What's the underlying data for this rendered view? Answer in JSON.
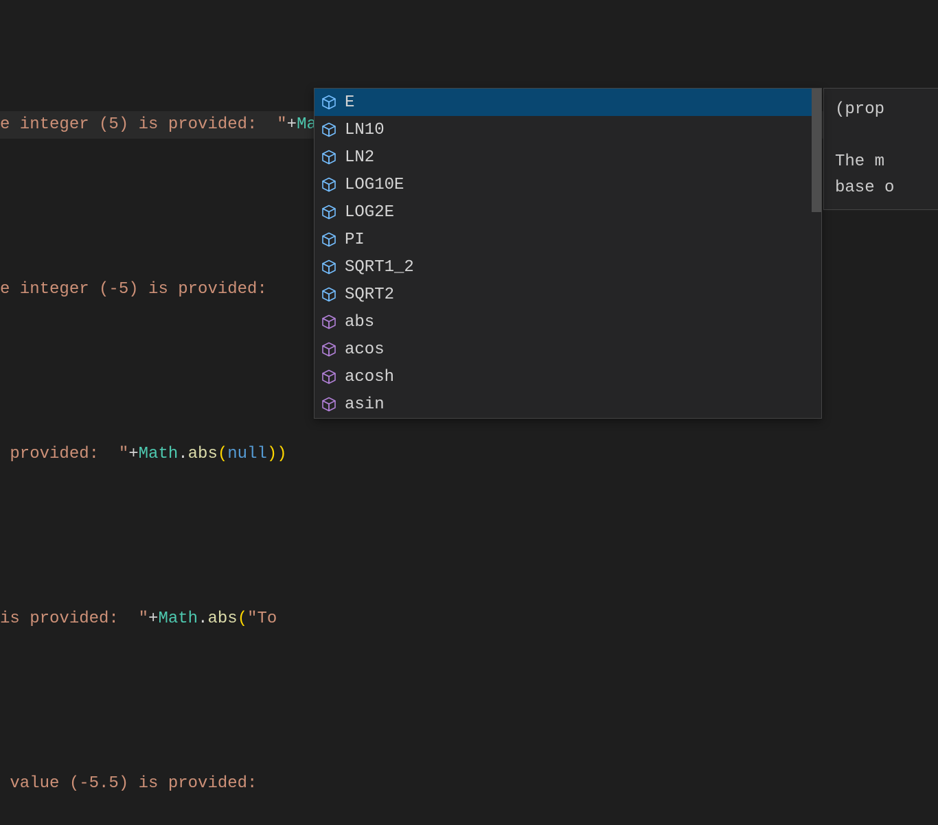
{
  "code": {
    "line1": {
      "pre_string": "e integer (5) is provided:  \"",
      "plus": "+",
      "class": "Math",
      "dot": ".",
      "paren_close": ")",
      "semi": ";"
    },
    "line3": {
      "text": "e integer (-5) is provided: "
    },
    "line5": {
      "pre_string": " provided:  \"",
      "plus": "+",
      "class": "Math",
      "dot": ".",
      "method": "abs",
      "paren_open": "(",
      "null_kw": "null",
      "paren_close": ")",
      "tail": ")"
    },
    "line7": {
      "pre_string": "is provided:  \"",
      "plus": "+",
      "class": "Math",
      "dot": ".",
      "method": "abs",
      "paren_open": "(",
      "string_arg": "\"To"
    },
    "line9": {
      "text": " value (-5.5) is provided: "
    }
  },
  "autocomplete": {
    "items": [
      {
        "label": "E",
        "kind": "property",
        "selected": true
      },
      {
        "label": "LN10",
        "kind": "property",
        "selected": false
      },
      {
        "label": "LN2",
        "kind": "property",
        "selected": false
      },
      {
        "label": "LOG10E",
        "kind": "property",
        "selected": false
      },
      {
        "label": "LOG2E",
        "kind": "property",
        "selected": false
      },
      {
        "label": "PI",
        "kind": "property",
        "selected": false
      },
      {
        "label": "SQRT1_2",
        "kind": "property",
        "selected": false
      },
      {
        "label": "SQRT2",
        "kind": "property",
        "selected": false
      },
      {
        "label": "abs",
        "kind": "method",
        "selected": false
      },
      {
        "label": "acos",
        "kind": "method",
        "selected": false
      },
      {
        "label": "acosh",
        "kind": "method",
        "selected": false
      },
      {
        "label": "asin",
        "kind": "method",
        "selected": false
      }
    ]
  },
  "doc_panel": {
    "line1": "(prop",
    "line2": "The m",
    "line3": "base o"
  },
  "icons": {
    "property_color": "#75beff",
    "method_color": "#b180d7"
  }
}
